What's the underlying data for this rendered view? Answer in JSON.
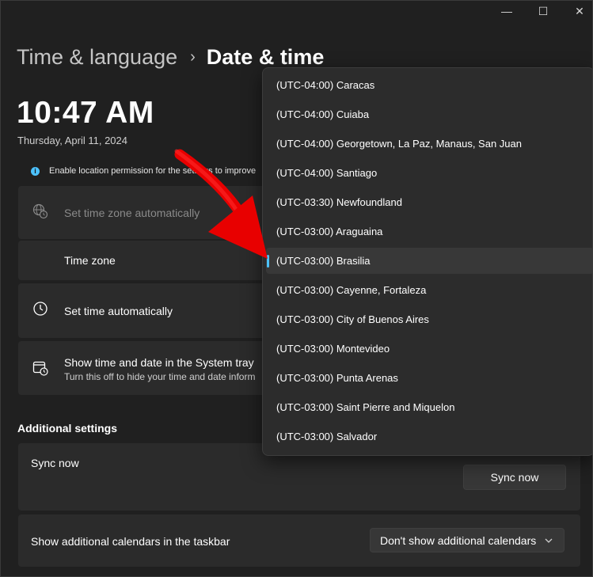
{
  "window": {
    "controls": {
      "minimize": "—",
      "maximize": "☐",
      "close": "✕"
    }
  },
  "breadcrumb": {
    "parent": "Time & language",
    "separator": "›",
    "current": "Date & time"
  },
  "clock": {
    "time": "10:47 AM",
    "date": "Thursday, April 11, 2024"
  },
  "info_bar": {
    "text": "Enable location permission for the settings to improve"
  },
  "settings": {
    "auto_timezone": {
      "label": "Set time zone automatically",
      "icon": "globe-clock-icon"
    },
    "timezone": {
      "label": "Time zone"
    },
    "auto_time": {
      "label": "Set time automatically",
      "icon": "clock-icon"
    },
    "tray": {
      "label": "Show time and date in the System tray",
      "sublabel": "Turn this off to hide your time and date inform",
      "icon": "calendar-clock-icon"
    }
  },
  "additional": {
    "title": "Additional settings",
    "sync_label": "Sync now",
    "sync_button": "Sync now",
    "calendars_label": "Show additional calendars in the taskbar",
    "calendars_value": "Don't show additional calendars",
    "calendars_chevron": "chevron-down-icon"
  },
  "timezone_dropdown": {
    "items": [
      "(UTC-04:00) Caracas",
      "(UTC-04:00) Cuiaba",
      "(UTC-04:00) Georgetown, La Paz, Manaus, San Juan",
      "(UTC-04:00) Santiago",
      "(UTC-03:30) Newfoundland",
      "(UTC-03:00) Araguaina",
      "(UTC-03:00) Brasilia",
      "(UTC-03:00) Cayenne, Fortaleza",
      "(UTC-03:00) City of Buenos Aires",
      "(UTC-03:00) Montevideo",
      "(UTC-03:00) Punta Arenas",
      "(UTC-03:00) Saint Pierre and Miquelon",
      "(UTC-03:00) Salvador"
    ],
    "selected_index": 6
  },
  "colors": {
    "accent": "#4cc2ff",
    "annotation_arrow": "#ff0000"
  }
}
